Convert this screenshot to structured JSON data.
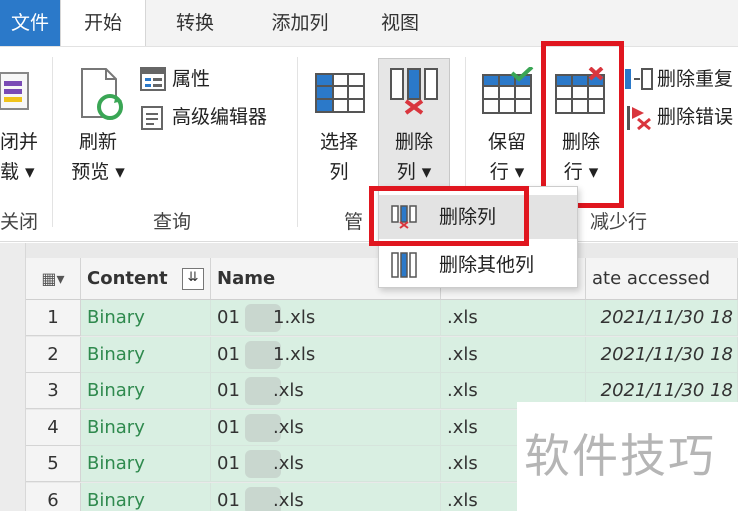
{
  "tabs": {
    "file": "文件",
    "home": "开始",
    "transform": "转换",
    "add_column": "添加列",
    "view": "视图"
  },
  "ribbon": {
    "close_load": {
      "line1": "闭并",
      "line2": "载 ▾",
      "group": "关闭"
    },
    "refresh_preview": {
      "line1": "刷新",
      "line2": "预览 ▾"
    },
    "properties": "属性",
    "advanced_editor": "高级编辑器",
    "query_group": "查询",
    "choose_columns": {
      "line1": "选择",
      "line2": "列"
    },
    "remove_columns": {
      "line1": "删除",
      "line2": "列 ▾"
    },
    "manage_group": "管",
    "keep_rows": {
      "line1": "保留",
      "line2": "行 ▾"
    },
    "remove_rows": {
      "line1": "删除",
      "line2": "行 ▾"
    },
    "remove_duplicates": "删除重复",
    "remove_errors": "删除错误",
    "reduce_rows_group": "减少行"
  },
  "dropdown": {
    "remove_columns": "删除列",
    "remove_other_columns": "删除其他列"
  },
  "table": {
    "headers": {
      "content": "Content",
      "name": "Name",
      "date_accessed": "ate accessed"
    },
    "rows": [
      {
        "index": "1",
        "content": "Binary",
        "name_prefix": "01",
        "name_suffix": "1.xls",
        "ext": ".xls",
        "date": "2021/11/30 18"
      },
      {
        "index": "2",
        "content": "Binary",
        "name_prefix": "01",
        "name_suffix": "1.xls",
        "ext": ".xls",
        "date": "2021/11/30 18"
      },
      {
        "index": "3",
        "content": "Binary",
        "name_prefix": "01",
        "name_suffix": ".xls",
        "ext": ".xls",
        "date": "2021/11/30 18"
      },
      {
        "index": "4",
        "content": "Binary",
        "name_prefix": "01",
        "name_suffix": ".xls",
        "ext": ".xls",
        "date": ""
      },
      {
        "index": "5",
        "content": "Binary",
        "name_prefix": "01",
        "name_suffix": ".xls",
        "ext": ".xls",
        "date": ""
      },
      {
        "index": "6",
        "content": "Binary",
        "name_prefix": "01",
        "name_suffix": ".xls",
        "ext": ".xls",
        "date": ""
      }
    ]
  },
  "watermark": "软件技巧",
  "colors": {
    "file_tab": "#2b79c9",
    "highlight_frame": "#e0161f",
    "cell_bg": "#d9efe2",
    "binary_text": "#2f8a4e"
  }
}
